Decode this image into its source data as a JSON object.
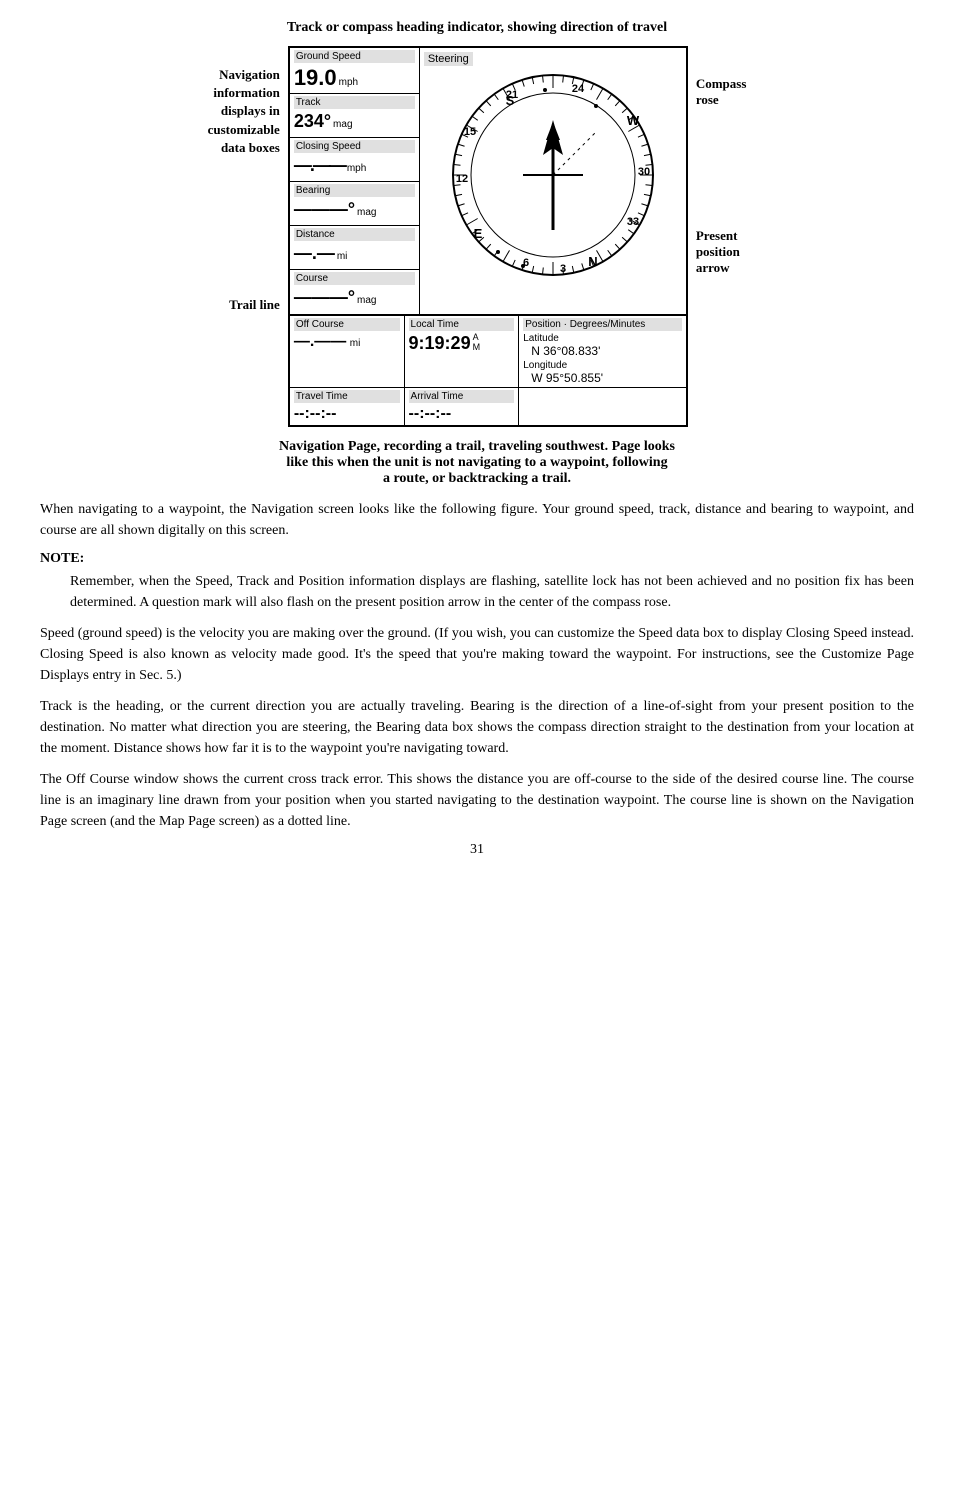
{
  "header": {
    "title": "Track or compass heading indicator, showing direction of travel"
  },
  "left_labels": {
    "nav_info": "Navigation\ninformation\ndisplays in\ncustomizable\ndata boxes",
    "trail_line": "Trail line"
  },
  "right_labels": {
    "compass_rose": "Compass\nrose",
    "present_position": "Present\nposition\narrow"
  },
  "data_boxes": [
    {
      "label": "Ground Speed",
      "value": "19.0",
      "unit": "mph"
    },
    {
      "label": "Track",
      "value": "234°",
      "unit": "mag"
    },
    {
      "label": "Closing Speed",
      "value": "—.——",
      "unit": "mph"
    },
    {
      "label": "Bearing",
      "value": "———°",
      "unit": "mag"
    },
    {
      "label": "Distance",
      "value": "—.—",
      "unit": "mi"
    },
    {
      "label": "Course",
      "value": "———°",
      "unit": "mag"
    }
  ],
  "steering_label": "Steering",
  "compass": {
    "numbers": [
      "21",
      "24",
      "W",
      "30",
      "33",
      "N",
      "3",
      "6",
      "E",
      "12",
      "15",
      "S"
    ]
  },
  "bottom_boxes": [
    {
      "label": "Off Course",
      "value": "—.——",
      "unit": "mi"
    },
    {
      "label": "Local Time",
      "value": "9:19:29",
      "ampm": "A\nM"
    },
    {
      "label": "Position · Degrees/Minutes",
      "sublabels": [
        "Latitude",
        "Longitude"
      ],
      "values": [
        "N   36°08.833'",
        "W   95°50.855'"
      ]
    }
  ],
  "bottom_row2": [
    {
      "label": "Travel Time",
      "value": "--:--:--"
    },
    {
      "label": "Arrival Time",
      "value": "--:--:--"
    }
  ],
  "caption": "Navigation Page, recording a trail, traveling southwest. Page looks\nlike this when the unit is not navigating to a waypoint, following\na route, or backtracking a trail.",
  "paragraphs": [
    "When navigating to a waypoint, the Navigation screen looks like the following figure. Your ground speed, track, distance and bearing to waypoint, and course are all shown digitally on this screen.",
    "NOTE:",
    "Remember, when the Speed, Track and Position information displays are flashing, satellite lock has not been achieved and no position fix has been determined. A question mark will also flash on the present position arrow in the center of the compass rose.",
    "Speed (ground speed) is the velocity you are making over the ground. (If you wish, you can customize the Speed data box to display Closing Speed instead. Closing Speed is also known as velocity made good. It's the speed that you're making toward the waypoint. For instructions, see the Customize Page Displays entry in Sec. 5.)",
    "Track is the heading, or the current direction you are actually traveling. Bearing is the direction of a line-of-sight from your present position to the destination. No matter what direction you are steering, the Bearing data box shows the compass direction straight to the destination from your location at the moment. Distance shows how far it is to the waypoint you're navigating toward.",
    "The Off Course window shows the current cross track error. This shows the distance you are off-course to the side of the desired course line. The course line is an imaginary line drawn from your position when you started navigating to the destination waypoint. The course line is shown on the Navigation Page screen (and the Map Page screen) as a dotted line."
  ],
  "page_number": "31"
}
